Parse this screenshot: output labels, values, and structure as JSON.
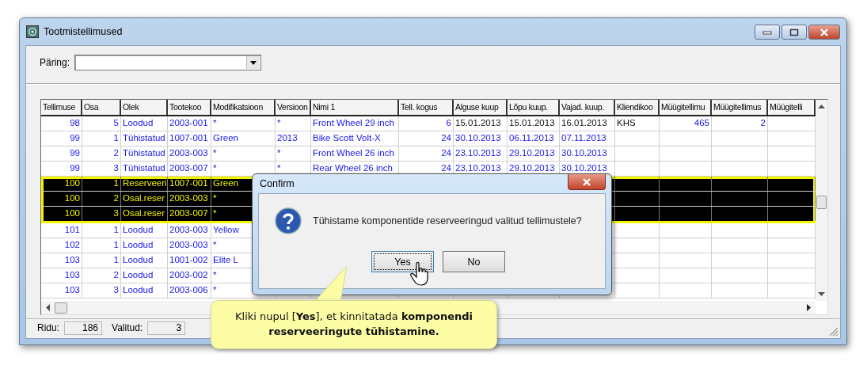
{
  "window": {
    "title": "Tootmistellimused"
  },
  "query": {
    "label": "Päring:"
  },
  "table": {
    "columns": [
      {
        "label": "Tellimuse",
        "numeric": true
      },
      {
        "label": "Osa",
        "numeric": true
      },
      {
        "label": "Olek",
        "numeric": false
      },
      {
        "label": "Tootekoo",
        "numeric": false
      },
      {
        "label": "Modifikatsioon",
        "numeric": false
      },
      {
        "label": "Versioon",
        "numeric": false
      },
      {
        "label": "Nimi 1",
        "numeric": false
      },
      {
        "label": "Tell. kogus",
        "numeric": true
      },
      {
        "label": "Alguse kuup",
        "numeric": false
      },
      {
        "label": "Lõpu kuup.",
        "numeric": false
      },
      {
        "label": "Vajad. kuup.",
        "numeric": false
      },
      {
        "label": "Kliendikoo",
        "numeric": false
      },
      {
        "label": "Müügitellimu",
        "numeric": true
      },
      {
        "label": "Müügitellimus",
        "numeric": true
      },
      {
        "label": "Müügitelli"
      }
    ],
    "rows": [
      {
        "selected": false,
        "plain_dates": true,
        "cells": [
          "98",
          "5",
          "Loodud",
          "2003-001",
          "*",
          "*",
          "Front Wheel 29 inch",
          "6",
          "15.01.2013",
          "15.01.2013",
          "16.01.2013",
          "KHS",
          "465",
          "2"
        ]
      },
      {
        "selected": false,
        "cells": [
          "99",
          "1",
          "Tühistatud",
          "1007-001",
          "Green",
          "2013",
          "Bike Scott Volt-X",
          "24",
          "30.10.2013",
          "06.11.2013",
          "07.11.2013"
        ]
      },
      {
        "selected": false,
        "cells": [
          "99",
          "2",
          "Tühistatud",
          "2003-003",
          "*",
          "*",
          "Front Wheel 26 inch",
          "24",
          "23.10.2013",
          "29.10.2013",
          "30.10.2013"
        ]
      },
      {
        "selected": false,
        "cells": [
          "99",
          "3",
          "Tühistatud",
          "2003-007",
          "*",
          "*",
          "Rear Wheel 26 inch",
          "24",
          "23.10.2013",
          "29.10.2013",
          "30.10.2013"
        ]
      },
      {
        "selected": true,
        "cells": [
          "100",
          "1",
          "Reserveeri",
          "1007-001",
          "Green"
        ]
      },
      {
        "selected": true,
        "cells": [
          "100",
          "2",
          "Osal.reser",
          "2003-003",
          "*"
        ]
      },
      {
        "selected": true,
        "cells": [
          "100",
          "3",
          "Osal.reser",
          "2003-007",
          "*"
        ]
      },
      {
        "selected": false,
        "cells": [
          "101",
          "1",
          "Loodud",
          "2003-003",
          "Yellow"
        ]
      },
      {
        "selected": false,
        "cells": [
          "102",
          "1",
          "Loodud",
          "2003-003",
          "*"
        ]
      },
      {
        "selected": false,
        "cells": [
          "103",
          "1",
          "Loodud",
          "1001-002",
          "Elite L"
        ]
      },
      {
        "selected": false,
        "cells": [
          "103",
          "2",
          "Loodud",
          "2003-002",
          "*"
        ]
      },
      {
        "selected": false,
        "cells": [
          "103",
          "3",
          "Loodud",
          "2003-006",
          "*"
        ]
      }
    ]
  },
  "status_bar": [
    {
      "label": "Ridu:",
      "value": "186"
    },
    {
      "label": "Valitud:",
      "value": "3"
    }
  ],
  "dialog": {
    "title": "Confirm",
    "message": "Tühistame komponentide reserveeringud valitud tellimustele?",
    "buttons": [
      {
        "label": "Yes",
        "focused": true
      },
      {
        "label": "No",
        "focused": false
      }
    ]
  },
  "callout": {
    "text": "Kliki nupul [**Yes**], et kinnitatada **komponendi reserveeringute tühistamine.**"
  }
}
